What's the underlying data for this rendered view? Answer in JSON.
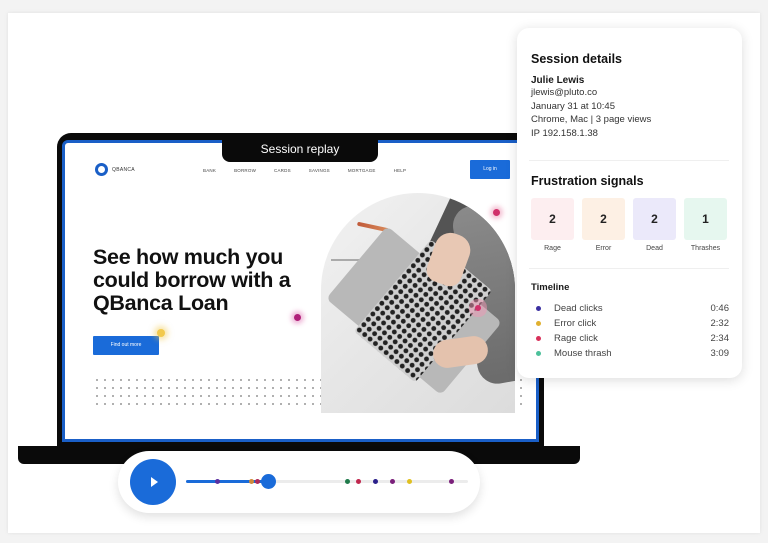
{
  "replay_tab": {
    "label": "Session replay"
  },
  "site": {
    "logo_text": "QBANCA",
    "nav": [
      "BANK",
      "BORROW",
      "CARDS",
      "SAVINGS",
      "MORTGAGE",
      "HELP"
    ],
    "login_label": "Log in",
    "hero_title": "See how much you could borrow with a QBanca Loan",
    "cta_label": "Find out more"
  },
  "player": {
    "play_icon": "play-icon",
    "progress": 0.29,
    "markers": [
      {
        "position": 0.11,
        "color": "#5b2fa0"
      },
      {
        "position": 0.23,
        "color": "#d08a3a"
      },
      {
        "position": 0.25,
        "color": "#b02a5a"
      },
      {
        "position": 0.57,
        "color": "#1f7a4a"
      },
      {
        "position": 0.61,
        "color": "#c0264d"
      },
      {
        "position": 0.67,
        "color": "#2a1f8a"
      },
      {
        "position": 0.73,
        "color": "#7a1f7a"
      },
      {
        "position": 0.79,
        "color": "#e0c020"
      },
      {
        "position": 0.94,
        "color": "#7a1f7a"
      }
    ],
    "accent": "#1a6bd9"
  },
  "session_details": {
    "title": "Session details",
    "name": "Julie Lewis",
    "email": "jlewis@pluto.co",
    "date": "January 31 at 10:45",
    "device": "Chrome, Mac | 3 page views",
    "ip": "IP 192.158.1.38"
  },
  "frustration": {
    "title": "Frustration signals",
    "signals": [
      {
        "label": "Rage",
        "count": "2",
        "color": "#fdeef0"
      },
      {
        "label": "Error",
        "count": "2",
        "color": "#fdf0e4"
      },
      {
        "label": "Dead",
        "count": "2",
        "color": "#ebe9fa"
      },
      {
        "label": "Thrashes",
        "count": "1",
        "color": "#e6f7ef"
      }
    ]
  },
  "timeline": {
    "title": "Timeline",
    "events": [
      {
        "label": "Dead clicks",
        "time": "0:46",
        "color": "#3b2fa0"
      },
      {
        "label": "Error click",
        "time": "2:32",
        "color": "#e0b030"
      },
      {
        "label": "Rage click",
        "time": "2:34",
        "color": "#d8305a"
      },
      {
        "label": "Mouse thrash",
        "time": "3:09",
        "color": "#4cc09a"
      }
    ]
  }
}
